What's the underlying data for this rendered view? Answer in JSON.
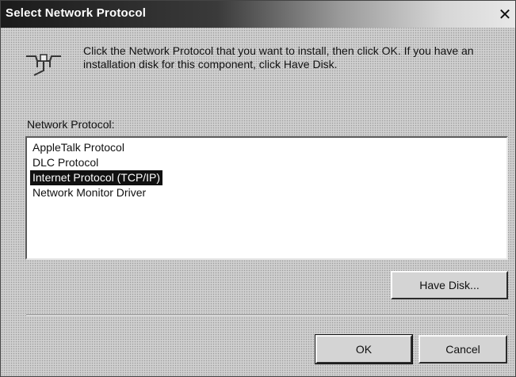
{
  "window": {
    "title": "Select Network Protocol",
    "close_symbol": "✕"
  },
  "icon": {
    "name": "network-connector-icon"
  },
  "instruction": "Click the Network Protocol that you want to install, then click OK. If you have an installation disk for this component, click Have Disk.",
  "protocol_list": {
    "label": "Network Protocol:",
    "items": [
      {
        "label": "AppleTalk Protocol",
        "selected": false
      },
      {
        "label": "DLC Protocol",
        "selected": false
      },
      {
        "label": "Internet Protocol (TCP/IP)",
        "selected": true
      },
      {
        "label": "Network Monitor Driver",
        "selected": false
      }
    ]
  },
  "buttons": {
    "have_disk": "Have Disk...",
    "ok": "OK",
    "cancel": "Cancel"
  }
}
